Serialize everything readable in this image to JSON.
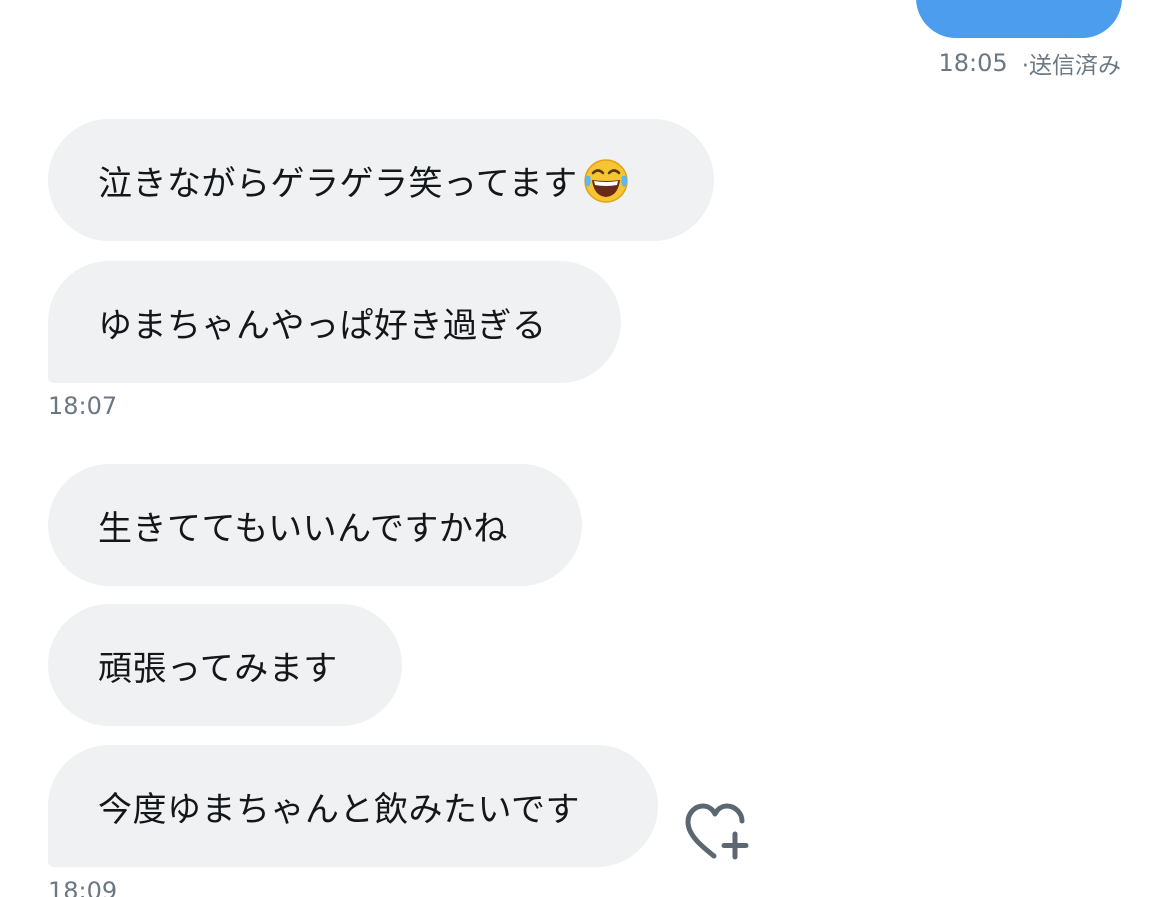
{
  "sent": {
    "time": "18:05",
    "status": "·送信済み",
    "bubble_color": "#4c9ded"
  },
  "received": {
    "bubble_color": "#eff1f3",
    "groups": [
      {
        "messages": [
          {
            "text": "泣きながらゲラゲラ笑ってます",
            "emoji": "face-with-tears-of-joy-icon"
          },
          {
            "text": "ゆまちゃんやっぱ好き過ぎる"
          }
        ],
        "time": "18:07"
      },
      {
        "messages": [
          {
            "text": "生きててもいいんですかね"
          },
          {
            "text": "頑張ってみます"
          },
          {
            "text": "今度ゆまちゃんと飲みたいです"
          }
        ],
        "time": "18:09"
      }
    ]
  },
  "actions": {
    "like_icon": "heart-plus-icon"
  },
  "colors": {
    "meta_text": "#6b7782",
    "message_text": "#14171a",
    "icon": "#5b6771"
  }
}
